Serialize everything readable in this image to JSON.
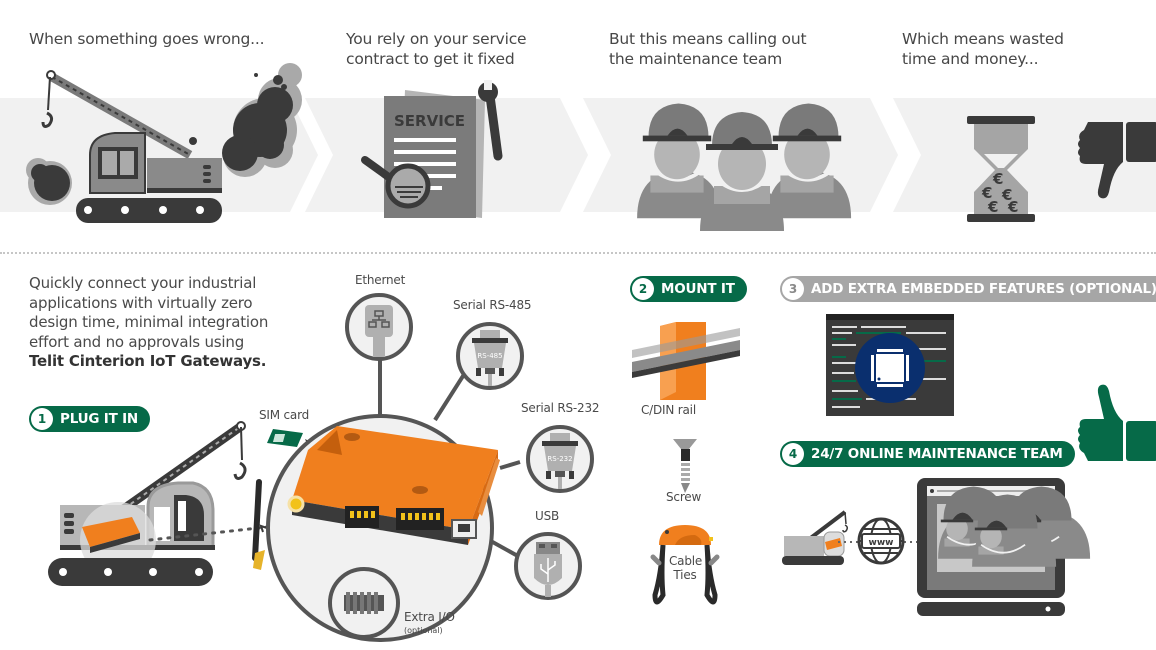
{
  "top_story": {
    "steps": [
      {
        "caption_line1": "When something goes wrong...",
        "caption_line2": "",
        "icon": "broken-crane-icon"
      },
      {
        "caption_line1": "You rely on your service",
        "caption_line2": "contract to get it fixed",
        "icon": "service-contract-icon",
        "document_label": "SERVICE"
      },
      {
        "caption_line1": "But this means calling out",
        "caption_line2": "the maintenance team",
        "icon": "maintenance-team-icon"
      },
      {
        "caption_line1": "Which means wasted",
        "caption_line2": "time and money...",
        "icon": "hourglass-euro-icon"
      }
    ],
    "verdict_icon": "thumbs-down-icon"
  },
  "intro": {
    "text": "Quickly connect your industrial applications with virtually zero design time, minimal integration effort and no approvals using",
    "lines": [
      "Quickly connect your industrial",
      "applications with virtually zero",
      "design time, minimal integration",
      "effort and no approvals using"
    ],
    "brand": "Telit Cinterion IoT Gateways."
  },
  "steps": [
    {
      "number": "1",
      "label": "PLUG IT IN",
      "style": "green"
    },
    {
      "number": "2",
      "label": "MOUNT IT",
      "style": "green"
    },
    {
      "number": "3",
      "label": "ADD EXTRA EMBEDDED FEATURES (OPTIONAL)",
      "style": "grey"
    },
    {
      "number": "4",
      "label": "24/7 ONLINE MAINTENANCE TEAM",
      "style": "green"
    }
  ],
  "gateway": {
    "sim_label": "SIM card",
    "interfaces": [
      {
        "label": "Ethernet",
        "icon": "ethernet-plug-icon"
      },
      {
        "label": "Serial RS-485",
        "icon": "serial-rs485-connector-icon",
        "connector_text": "RS-485"
      },
      {
        "label": "Serial RS-232",
        "icon": "serial-rs232-connector-icon",
        "connector_text": "RS-232"
      },
      {
        "label": "USB",
        "icon": "usb-plug-icon"
      },
      {
        "label": "Extra I/O",
        "sublabel": "(optional)",
        "icon": "extra-io-connector-icon"
      }
    ]
  },
  "mounting": {
    "items": [
      {
        "label": "C/DIN rail",
        "icon": "din-rail-icon"
      },
      {
        "label": "Screw",
        "icon": "screw-icon"
      },
      {
        "label_line1": "Cable",
        "label_line2": "Ties",
        "icon": "cable-ties-icon"
      }
    ]
  },
  "remote": {
    "globe_label": "www",
    "verdict_icon": "thumbs-up-icon"
  },
  "colors": {
    "green": "#066a48",
    "orange": "#f07f1e",
    "navy": "#0a2f6e",
    "dark_grey": "#3a3a3a",
    "band_grey": "#f1f1f1",
    "pill_grey": "#a6a6a6"
  }
}
